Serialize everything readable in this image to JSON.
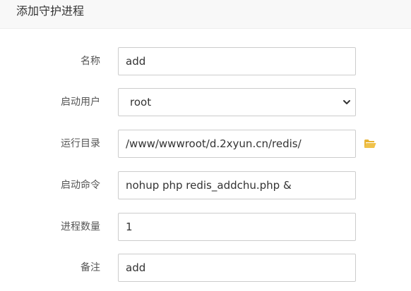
{
  "dialog": {
    "title": "添加守护进程"
  },
  "form": {
    "name": {
      "label": "名称",
      "value": "add"
    },
    "run_user": {
      "label": "启动用户",
      "value": "root"
    },
    "run_dir": {
      "label": "运行目录",
      "value": "/www/wwwroot/d.2xyun.cn/redis/",
      "icon": "folder-open-icon"
    },
    "start_cmd": {
      "label": "启动命令",
      "value": "nohup php redis_addchu.php &"
    },
    "process_count": {
      "label": "进程数量",
      "value": "1"
    },
    "remark": {
      "label": "备注",
      "value": "add"
    }
  },
  "colors": {
    "header_bg": "#f8f8f8",
    "border": "#cccccc",
    "folder_icon": "#e8b332"
  }
}
